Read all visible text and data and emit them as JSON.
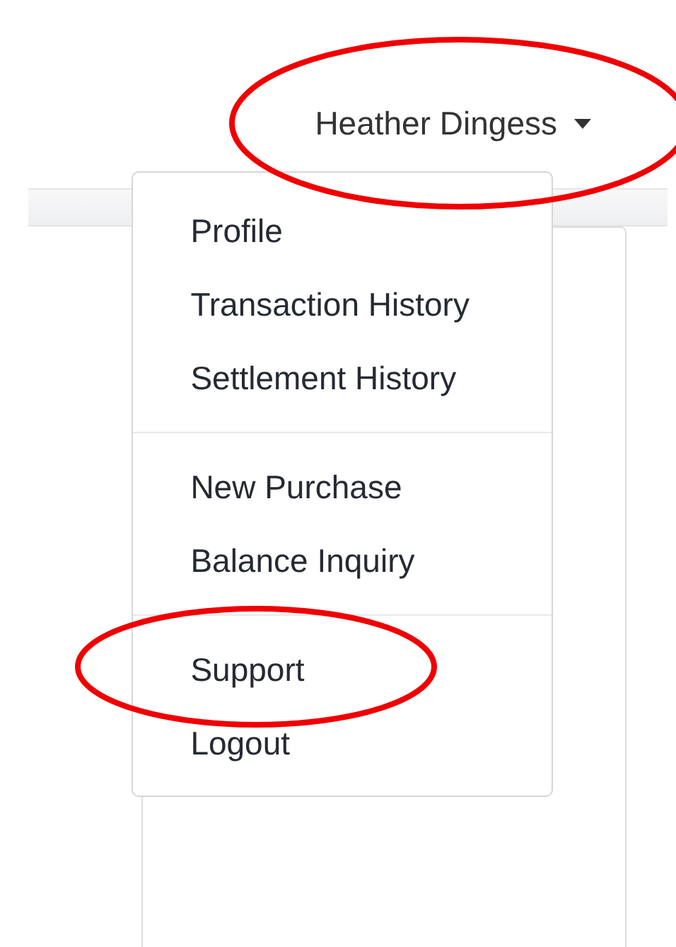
{
  "navbar": {
    "user_menu": {
      "label": "Heather Dingess",
      "expanded": true,
      "circled": true
    }
  },
  "dropdown": {
    "groups": [
      {
        "items": [
          {
            "label": "Profile",
            "circled": false
          },
          {
            "label": "Transaction History",
            "circled": false
          },
          {
            "label": "Settlement History",
            "circled": false
          }
        ]
      },
      {
        "items": [
          {
            "label": "New Purchase",
            "circled": false
          },
          {
            "label": "Balance Inquiry",
            "circled": false
          }
        ]
      },
      {
        "items": [
          {
            "label": "Support",
            "circled": true
          },
          {
            "label": "Logout",
            "circled": false
          }
        ]
      }
    ]
  }
}
